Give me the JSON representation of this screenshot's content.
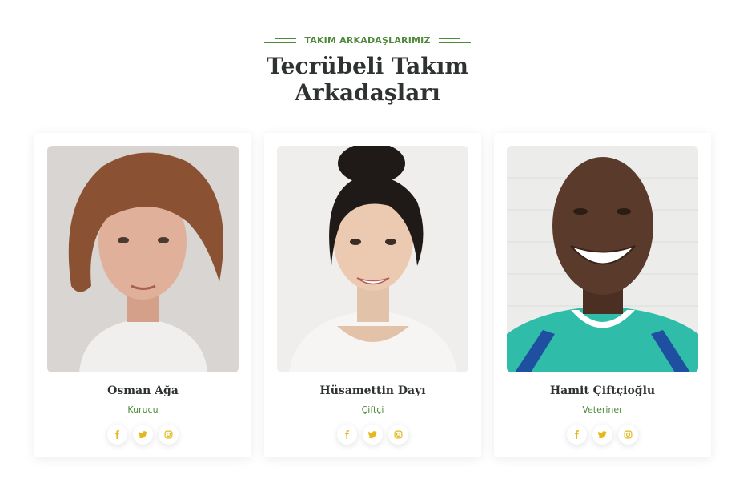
{
  "section": {
    "eyebrow": "TAKIM ARKADAŞLARIMIZ",
    "title_line1": "Tecrübeli Takım",
    "title_line2": "Arkadaşları"
  },
  "colors": {
    "accent_green": "#4f8a3a",
    "icon_yellow": "#e3b71d",
    "heading": "#2e3330"
  },
  "team": [
    {
      "name": "Osman Ağa",
      "role": "Kurucu",
      "photo": "team-member-photo"
    },
    {
      "name": "Hüsamettin Dayı",
      "role": "Çiftçi",
      "photo": "team-member-photo"
    },
    {
      "name": "Hamit Çiftçioğlu",
      "role": "Veteriner",
      "photo": "team-member-photo"
    }
  ],
  "social_icons": [
    "facebook-icon",
    "twitter-icon",
    "instagram-icon"
  ]
}
